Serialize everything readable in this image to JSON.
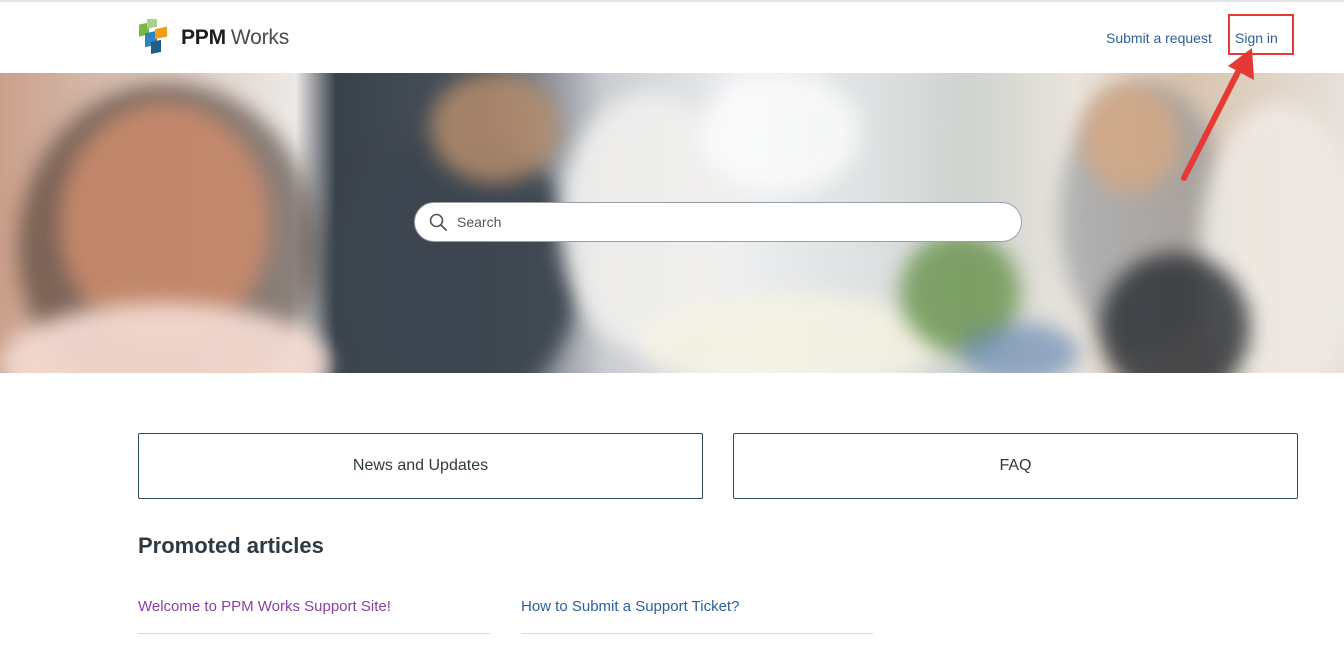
{
  "header": {
    "logo": {
      "brand_bold": "PPM",
      "brand_rest": "Works"
    },
    "nav": {
      "submit_request": "Submit a request",
      "sign_in": "Sign in"
    }
  },
  "hero": {
    "search": {
      "placeholder": "Search",
      "value": ""
    }
  },
  "categories": [
    {
      "label": "News and Updates"
    },
    {
      "label": "FAQ"
    }
  ],
  "promoted": {
    "title": "Promoted articles",
    "articles": [
      {
        "label": "Welcome to PPM Works Support Site!",
        "state": "visited"
      },
      {
        "label": "How to Submit a Support Ticket?",
        "state": "unvisited"
      }
    ]
  },
  "colors": {
    "link": "#2c5f9e",
    "visited_link": "#8a3fa6",
    "category_border": "#2d4a5a",
    "annotation_red": "#e53935",
    "logo_green": "#7ab648",
    "logo_blue": "#2e86c1",
    "logo_orange": "#f39c12"
  },
  "icons": [
    "ppm-logo-icon",
    "search-icon",
    "annotation-arrow-icon"
  ]
}
